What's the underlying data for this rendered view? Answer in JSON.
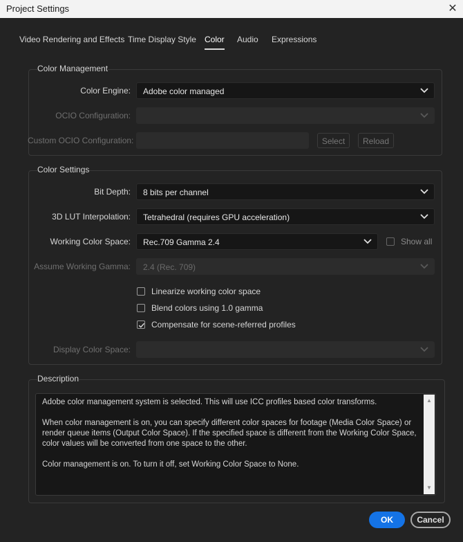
{
  "window": {
    "title": "Project Settings",
    "close_glyph": "✕"
  },
  "tabs": [
    {
      "label": "Video Rendering and Effects"
    },
    {
      "label": "Time Display Style"
    },
    {
      "label": "Color",
      "active": true
    },
    {
      "label": "Audio"
    },
    {
      "label": "Expressions"
    }
  ],
  "color_management": {
    "title": "Color Management",
    "color_engine": {
      "label": "Color Engine:",
      "value": "Adobe color managed"
    },
    "ocio_configuration": {
      "label": "OCIO Configuration:",
      "value": ""
    },
    "custom_ocio": {
      "label": "Custom OCIO Configuration:",
      "value": "",
      "select_label": "Select",
      "reload_label": "Reload"
    }
  },
  "color_settings": {
    "title": "Color Settings",
    "bit_depth": {
      "label": "Bit Depth:",
      "value": "8 bits per channel"
    },
    "lut_interpolation": {
      "label": "3D LUT Interpolation:",
      "value": "Tetrahedral (requires GPU acceleration)"
    },
    "working_color_space": {
      "label": "Working Color Space:",
      "value": "Rec.709 Gamma 2.4",
      "show_all_label": "Show all",
      "show_all_checked": false
    },
    "assume_working_gamma": {
      "label": "Assume Working Gamma:",
      "value": "2.4 (Rec. 709)"
    },
    "options": [
      {
        "label": "Linearize working color space",
        "checked": false
      },
      {
        "label": "Blend colors using 1.0 gamma",
        "checked": false
      },
      {
        "label": "Compensate for scene-referred profiles",
        "checked": true
      }
    ],
    "display_color_space": {
      "label": "Display Color Space:",
      "value": ""
    }
  },
  "description": {
    "title": "Description",
    "paragraphs": [
      "Adobe color management system is selected. This will use ICC profiles based color transforms.",
      "When color management is on, you can specify different color spaces for footage (Media Color Space) or render queue items (Output Color Space). If the specified space is different from the Working Color Space, color values will be converted from one space to the other.",
      "Color management is on. To turn it off, set Working Color Space to None."
    ]
  },
  "footer": {
    "ok_label": "OK",
    "cancel_label": "Cancel"
  },
  "colors": {
    "accent": "#1473e6",
    "background": "#232323",
    "titlebar": "#f3f3f3"
  }
}
